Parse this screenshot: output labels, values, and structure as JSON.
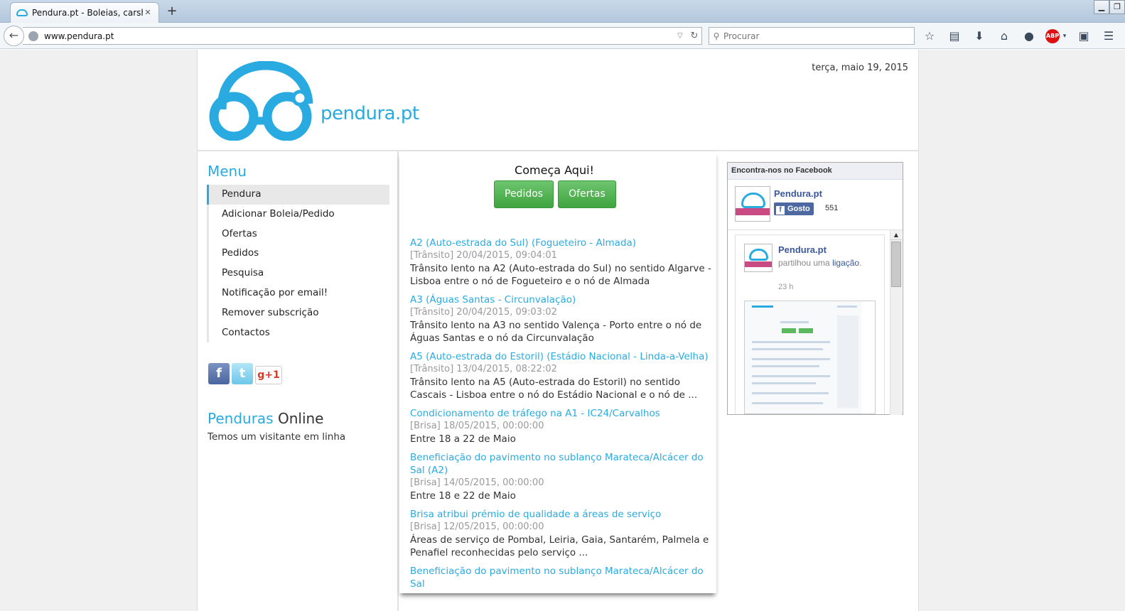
{
  "browser": {
    "tab_title": "Pendura.pt - Boleias, carsh...",
    "tab_close": "✕",
    "new_tab": "+",
    "win_minimize": "▁",
    "win_restore": "❐",
    "url": "www.pendura.pt",
    "search_placeholder": "Procurar",
    "tool_icons": [
      "star-icon",
      "reading-list-icon",
      "download-icon",
      "home-icon",
      "chat-icon",
      "adblock-plus-icon",
      "screenshot-icon",
      "menu-icon"
    ]
  },
  "site": {
    "brand": "pendura.pt",
    "date": "terça, maio 19, 2015",
    "brand_color": "#29abe2"
  },
  "menu": {
    "title": "Menu",
    "items": [
      {
        "label": "Pendura",
        "active": true
      },
      {
        "label": "Adicionar Boleia/Pedido"
      },
      {
        "label": "Ofertas"
      },
      {
        "label": "Pedidos"
      },
      {
        "label": "Pesquisa"
      },
      {
        "label": "Notificação por email!"
      },
      {
        "label": "Remover subscrição"
      },
      {
        "label": "Contactos"
      }
    ]
  },
  "social": {
    "facebook": "f",
    "twitter": "t",
    "gplus": "g+1"
  },
  "online": {
    "title_a": "Penduras",
    "title_b": "Online",
    "text": "Temos um visitante em linha"
  },
  "start": {
    "title": "Começa Aqui!",
    "btn_pedidos": "Pedidos",
    "btn_ofertas": "Ofertas"
  },
  "news": [
    {
      "title": "A2 (Auto-estrada do Sul) (Fogueteiro - Almada)",
      "meta": "[Trânsito] 20/04/2015, 09:04:01",
      "text": "Trânsito lento na A2 (Auto-estrada do Sul) no sentido Algarve - Lisboa entre o nó de Fogueteiro e o nó de Almada"
    },
    {
      "title": "A3 (Águas Santas - Circunvalação)",
      "meta": "[Trânsito] 20/04/2015, 09:03:02",
      "text": "Trânsito lento na A3 no sentido Valença - Porto entre o nó de Águas Santas e o nó da Circunvalação"
    },
    {
      "title": "A5 (Auto-estrada do Estoril) (Estádio Nacional - Linda-a-Velha)",
      "meta": "[Trânsito] 13/04/2015, 08:22:02",
      "text": "Trânsito lento na A5 (Auto-estrada do Estoril) no sentido Cascais - Lisboa entre o nó do Estádio Nacional e o nó de ..."
    },
    {
      "title": "Condicionamento de tráfego na A1 - IC24/Carvalhos",
      "meta": "[Brisa] 18/05/2015, 00:00:00",
      "text": "Entre 18 a 22 de Maio"
    },
    {
      "title": "Beneficiação do pavimento no sublanço Marateca/Alcácer do Sal (A2)",
      "meta": "[Brisa] 14/05/2015, 00:00:00",
      "text": "Entre 18 e 22 de Maio"
    },
    {
      "title": "Brisa atribui prémio de qualidade a áreas de serviço",
      "meta": "[Brisa] 12/05/2015, 00:00:00",
      "text": "Áreas de serviço de Pombal, Leiria, Gaia, Santarém, Palmela e Penafiel reconhecidas pelo serviço ..."
    },
    {
      "title": "Beneficiação do pavimento no sublanço Marateca/Alcácer do Sal",
      "meta": "",
      "text": ""
    }
  ],
  "facebook": {
    "header": "Encontra-nos no Facebook",
    "page_name": "Pendura.pt",
    "like_label": "Gosto",
    "like_count": "551",
    "thumb_like": "Like",
    "post_name": "Pendura.pt",
    "post_sub": "partilhou uma",
    "post_link": "ligação",
    "post_period": ".",
    "post_time": "23 h"
  }
}
